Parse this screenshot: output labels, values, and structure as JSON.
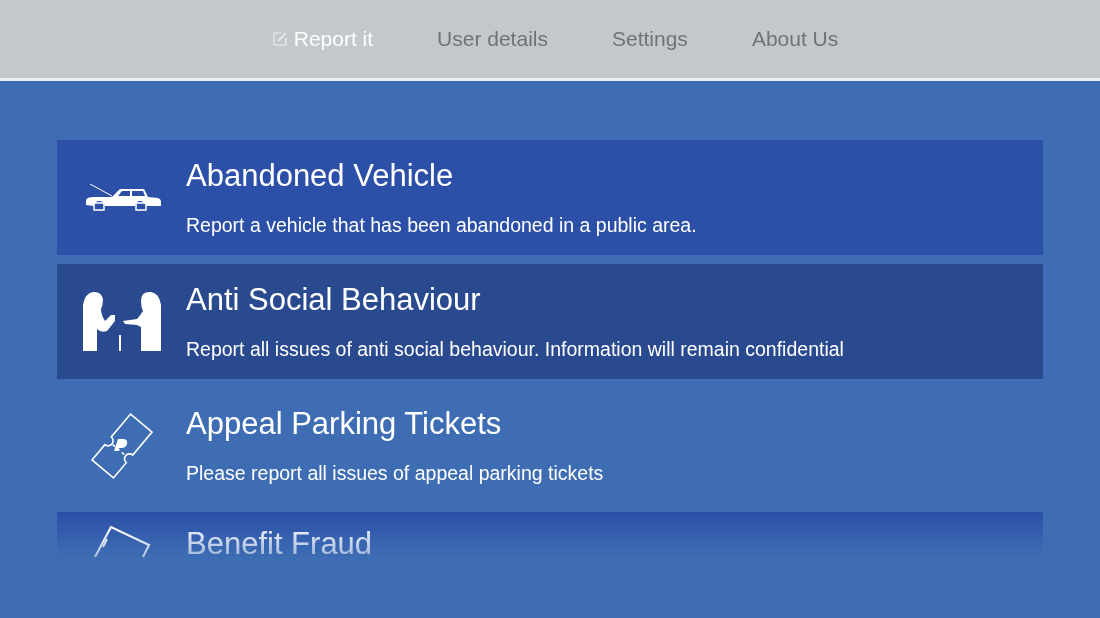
{
  "tabs": [
    {
      "label": "Report it",
      "selected": true,
      "icon": true
    },
    {
      "label": "User details",
      "selected": false
    },
    {
      "label": "Settings",
      "selected": false
    },
    {
      "label": "About Us",
      "selected": false
    }
  ],
  "services": [
    {
      "kind": "car",
      "title": "Abandoned Vehicle",
      "description": "Report a vehicle that has been abandoned in a public area.",
      "highlighted": true,
      "selected": false
    },
    {
      "kind": "people",
      "title": "Anti Social Behaviour",
      "description": "Report all issues of anti social behaviour. Information will remain confidential",
      "highlighted": true,
      "selected": true
    },
    {
      "kind": "ticket",
      "title": "Appeal Parking Tickets",
      "description": "Please report all issues of appeal parking tickets",
      "highlighted": false,
      "selected": false
    },
    {
      "kind": "card",
      "title": "Benefit Fraud",
      "highlighted": true,
      "selected": false
    }
  ]
}
